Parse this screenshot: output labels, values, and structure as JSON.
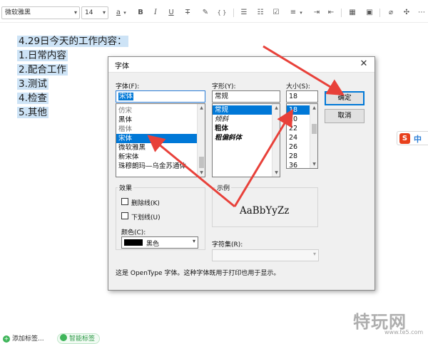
{
  "toolbar": {
    "font_name": "微软雅黑",
    "font_size": "14",
    "text_color_glyph": "a",
    "bold": "B",
    "italic": "I",
    "underline": "U",
    "strikethrough": "T",
    "code": "{ }",
    "icons": [
      "text-color-icon",
      "bold-icon",
      "italic-icon",
      "underline-icon",
      "strikethrough-icon",
      "eraser-icon",
      "code-icon",
      "bullet-list-icon",
      "numbered-list-icon",
      "checklist-icon",
      "align-icon",
      "table-icon",
      "attachment-icon",
      "more-icon"
    ]
  },
  "document": {
    "lines": [
      "4.29日今天的工作内容：",
      "1.日常内容",
      "2.配合工作",
      "3.测试",
      "4.检查",
      "5.其他"
    ]
  },
  "dialog": {
    "title": "字体",
    "close_glyph": "✕",
    "font_label": "字体(F):",
    "font_value": "宋体",
    "font_list": [
      "仿宋",
      "黑体",
      "楷体",
      "宋体",
      "微软雅黑",
      "新宋体",
      "珠穆朗玛—乌金苏通体"
    ],
    "font_selected": "宋体",
    "style_label": "字形(Y):",
    "style_value": "常规",
    "style_list": [
      "常规",
      "倾斜",
      "粗体",
      "粗偏斜体"
    ],
    "style_selected": "常规",
    "size_label": "大小(S):",
    "size_value": "18",
    "size_list": [
      "18",
      "20",
      "22",
      "24",
      "26",
      "28",
      "36"
    ],
    "size_selected": "18",
    "ok_label": "确定",
    "cancel_label": "取消",
    "effects_label": "效果",
    "strikeout_label": "删除线(K)",
    "underline_label": "下划线(U)",
    "color_label": "颜色(C):",
    "color_value": "黑色",
    "color_hex": "#000000",
    "sample_label": "示例",
    "sample_text": "AaBbYyZz",
    "charset_label": "字符集(R):",
    "charset_value": "",
    "note": "这是 OpenType 字体。这种字体既用于打印也用于显示。"
  },
  "ime": {
    "logo": "S",
    "mode": "中"
  },
  "tags": {
    "add_label": "添加标签...",
    "smart_label": "智能标签"
  },
  "watermark": {
    "big": "特玩网",
    "small": "www.te5.com"
  },
  "colors": {
    "accent": "#0078d7",
    "arrow": "#e8413a",
    "highlight": "#cde3f6"
  }
}
